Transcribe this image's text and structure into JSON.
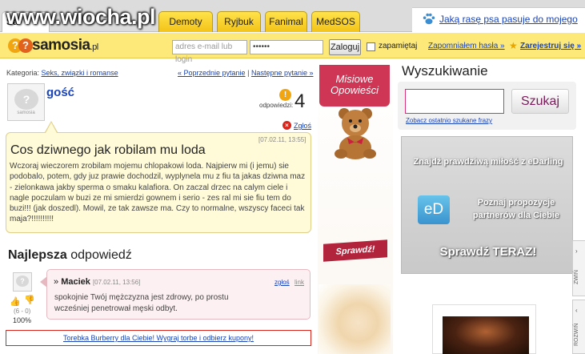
{
  "watermark": "www.wiocha.pl",
  "tabs": [
    "Sa",
    "Demoty",
    "Ryjbuk",
    "Fanimal",
    "MedSOS"
  ],
  "top_ad": {
    "text": "Jaką rasę psa pasuje do mojego"
  },
  "logo": {
    "name": "samosia",
    "suffix": ".pl",
    "icon": "question-icon"
  },
  "login": {
    "email_placeholder": "adres e-mail lub login",
    "password_value": "••••••",
    "login_button": "Zaloguj",
    "remember": "zapamiętaj",
    "forgot": "Zapomniałem hasła »",
    "register": "Zarejestruj się »"
  },
  "category": {
    "label": "Kategoria:",
    "value": "Seks, związki i romanse"
  },
  "question_nav": {
    "prev": "« Poprzednie pytanie",
    "sep": "|",
    "next": "Następne pytanie »"
  },
  "asker": {
    "name": "gość",
    "avatar_label": "samosia"
  },
  "answers": {
    "label": "odpowiedzi:",
    "count": "4"
  },
  "report_label": "Zgłoś",
  "question": {
    "date": "[07.02.11, 13:55]",
    "title": "Cos dziwnego jak robilam mu loda",
    "body": "Wczoraj wieczorem zrobilam mojemu chlopakowi loda. Najpierw mi (i jemu) sie podobalo, potem, gdy juz prawie dochodzil, wyplynela mu z fiu ta jakas dziwna maz - zielonkawa jakby sperma o smaku kalafiora. On zaczal drzec na calym ciele i nagle poczulam w buzi ze mi smierdzi gownem i serio - zes ral mi sie fiu tem do buzi!!! (jak doszedl). Mowil, ze tak zawsze ma. Czy to normalne, wszyscy faceci tak maja?!!!!!!!!!!"
  },
  "best_answer": {
    "heading_bold": "Najlepsza",
    "heading_rest": " odpowiedź",
    "author": "Maciek",
    "date": "[07.02.11, 13:56]",
    "report": "zgłoś",
    "link": "link",
    "text": "spokojnie Twój mężczyzna jest zdrowy, po prostu wcześniej penetrował męski odbyt.",
    "votes": "(6 - 0)",
    "percent": "100%"
  },
  "promo": "Torebka Burberry dla Ciebie! Wygraj torbe i odbierz kupony!",
  "mid_ad": {
    "banner": "Misiowe Opowieści",
    "button": "Sprawdź!"
  },
  "search": {
    "title": "Wyszukiwanie",
    "button": "Szukaj",
    "recent": "Zobacz ostatnio szukane frazy"
  },
  "edarling": {
    "headline": "Znajdź prawdziwą miłość z eDarling",
    "logo": "eD",
    "text": "Poznaj propozycje partnerów dla Ciebie",
    "cta": "Sprawdź TERAZ!"
  },
  "side_tabs": [
    "ZWIŃ",
    "ROZWIŃ"
  ]
}
